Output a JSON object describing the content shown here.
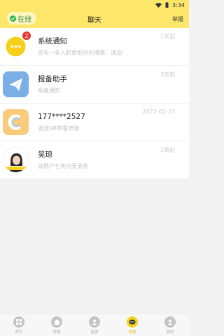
{
  "status_bar": {
    "time": "3:34"
  },
  "header": {
    "online_label": "在线",
    "title": "聊天",
    "report_label": "举报"
  },
  "conversations": [
    {
      "name": "系统通知",
      "preview": "您有一条入职审批待处理哦，请及!",
      "time": "1天前",
      "badge": "2",
      "avatar_icon": "chat-bubble-icon",
      "avatar_color": "#f6cf1a"
    },
    {
      "name": "报备助手",
      "preview": "报备通知",
      "time": "3天前",
      "badge": "",
      "avatar_icon": "paper-plane-icon",
      "avatar_color": "#7aaee6"
    },
    {
      "name": "177****2527",
      "preview": "发送VR带看申请",
      "time": "2022-02-23",
      "badge": "",
      "avatar_icon": "letter-c-logo-icon",
      "avatar_color": "#f8cc7a"
    },
    {
      "name": "吴琼",
      "preview": "该用户七天内无消息",
      "time": "1周前",
      "badge": "",
      "avatar_icon": "user-photo-avatar",
      "avatar_color": "#ffffff"
    }
  ],
  "tabbar": [
    {
      "label": "首页",
      "icon": "grid-icon",
      "active": false
    },
    {
      "label": "房源",
      "icon": "house-icon",
      "active": false
    },
    {
      "label": "客源",
      "icon": "person-icon",
      "active": false
    },
    {
      "label": "消息",
      "icon": "message-icon",
      "active": true
    },
    {
      "label": "我的",
      "icon": "profile-icon",
      "active": false
    }
  ],
  "colors": {
    "accent": "#fde76a",
    "badge": "#e8352b",
    "online": "#2db34a"
  }
}
